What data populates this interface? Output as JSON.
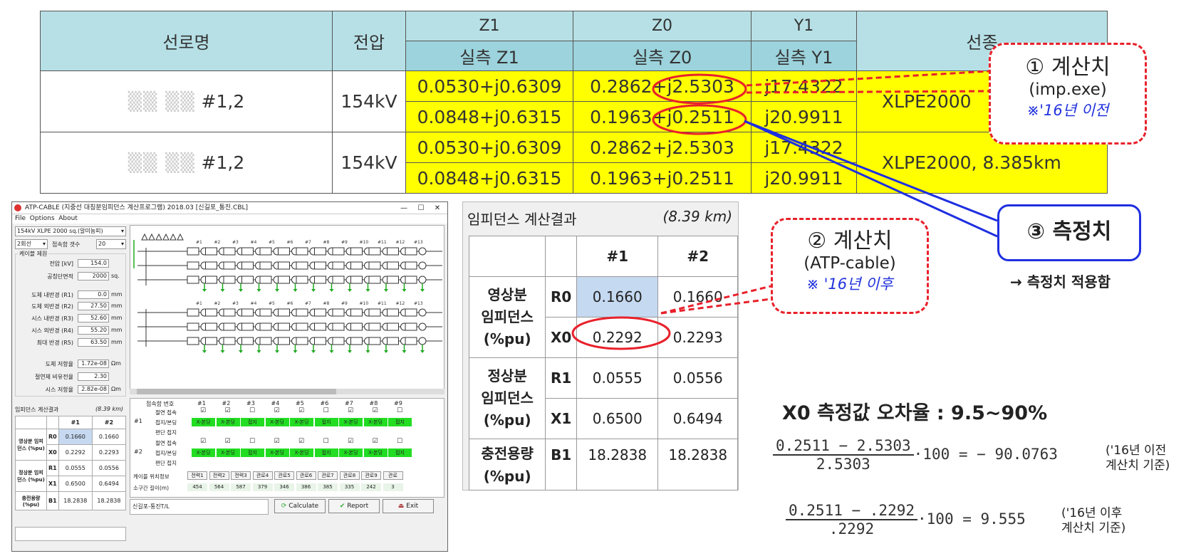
{
  "top_table": {
    "h_name": "선로명",
    "h_voltage": "전압",
    "h_z1": "Z1",
    "h_z0": "Z0",
    "h_y1": "Y1",
    "h_type": "선종",
    "h_meas_z1": "실측 Z1",
    "h_meas_z0": "실측 Z0",
    "h_meas_y1": "실측 Y1",
    "rows": [
      {
        "name": "#1,2",
        "voltage": "154kV",
        "z1_a": "0.0530+j0.6309",
        "z0_a": "0.2862+j2.5303",
        "y1_a": "j17.4322",
        "z1_b": "0.0848+j0.6315",
        "z0_b": "0.1963+j0.2511",
        "y1_b": "j20.9911",
        "type": "XLPE2000"
      },
      {
        "name": "#1,2",
        "voltage": "154kV",
        "z1_a": "0.0530+j0.6309",
        "z0_a": "0.2862+j2.5303",
        "y1_a": "j17.4322",
        "z1_b": "0.0848+j0.6315",
        "z0_b": "0.1963+j0.2511",
        "y1_b": "j20.9911",
        "type": "XLPE2000, 8.385km"
      }
    ]
  },
  "callouts": {
    "c1_title": "① 계산치",
    "c1_sub": "(imp.exe)",
    "c1_note": "※'16년 이전",
    "c2_title": "② 계산치",
    "c2_sub": "(ATP-cable)",
    "c2_note": "※ '16년 이후",
    "c3_title": "③ 측정치",
    "c3_arrow_note": "→ 측정치 적용함"
  },
  "atp": {
    "title": "ATP-CABLE (지중선 대칭분임피던스 계산프로그램) 2018.03 [신길포_통진.CBL]",
    "menu": [
      "File",
      "Options",
      "About"
    ],
    "cable_select": "154kV XLPE 2000 sq.(알미늄피)",
    "circuit_select": "2회선",
    "junction_label": "접속함 갯수",
    "junction_value": "20",
    "group_label": "케이블 제원",
    "params": [
      {
        "label": "전압 [kV]",
        "value": "154.0",
        "unit": ""
      },
      {
        "label": "공칭단면적",
        "value": "2000",
        "unit": "sq."
      },
      {
        "label": "도체 내반경 (R1)",
        "value": "0.0",
        "unit": "mm"
      },
      {
        "label": "도체 외반경 (R2)",
        "value": "27.50",
        "unit": "mm"
      },
      {
        "label": "시스 내반경 (R3)",
        "value": "52.60",
        "unit": "mm"
      },
      {
        "label": "시스 외반경 (R4)",
        "value": "55.20",
        "unit": "mm"
      },
      {
        "label": "최대 반경 (R5)",
        "value": "63.50",
        "unit": "mm"
      }
    ],
    "params2": [
      {
        "label": "도체 저항율",
        "value": "1.72e-08",
        "unit": "Ωm"
      },
      {
        "label": "절연체 비유전율",
        "value": "2.30",
        "unit": ""
      },
      {
        "label": "시스 저항율",
        "value": "2.82e-08",
        "unit": "Ωm"
      }
    ],
    "result_title": "임피던스 계산결과",
    "result_len": "(8.39 km)",
    "result": {
      "h1": "#1",
      "h2": "#2",
      "g1": "영상분 임피던스 (%pu)",
      "g2": "정상분 임피던스 (%pu)",
      "g3": "충전용량 (%pu)",
      "r0": [
        "R0",
        "0.1660",
        "0.1660"
      ],
      "x0": [
        "X0",
        "0.2292",
        "0.2293"
      ],
      "r1": [
        "R1",
        "0.0555",
        "0.0556"
      ],
      "x1": [
        "X1",
        "0.6500",
        "0.6494"
      ],
      "b1": [
        "B1",
        "18.2838",
        "18.2838"
      ]
    },
    "grid_header": [
      "접속함 번호",
      "#1",
      "#2",
      "#3",
      "#4",
      "#5",
      "#6",
      "#7",
      "#8",
      "#9"
    ],
    "grid_rows": [
      "절연 접속",
      "접지/본딩",
      "편단 접지",
      "절연 접속",
      "접지/본딩",
      "편단 접지"
    ],
    "grid_group": [
      "#1",
      "#2"
    ],
    "bond_cells": [
      "X-본딩",
      "X-본딩",
      "접지",
      "X-본딩",
      "X-본딩",
      "접지",
      "X-본딩",
      "X-본딩",
      "접지"
    ],
    "pos_label": "케이블 위치정보",
    "pos_values": [
      "전력1",
      "전력2",
      "전력3",
      "관로4",
      "관로5",
      "관로6",
      "관로7",
      "관로8",
      "관로9",
      "관로"
    ],
    "len_label": "소구간 길이(m)",
    "len_values": [
      "454",
      "564",
      "587",
      "379",
      "346",
      "386",
      "385",
      "335",
      "242",
      "3"
    ],
    "node_labels": [
      "#1",
      "#2",
      "#3",
      "#4",
      "#5",
      "#6",
      "#7",
      "#8",
      "#9",
      "#10",
      "#11",
      "#12",
      "#13"
    ],
    "status_text": "신길포-통진T/L",
    "btn_calc": "Calculate",
    "btn_report": "Report",
    "btn_exit": "Exit"
  },
  "imp_panel": {
    "title": "임피던스 계산결과",
    "length": "(8.39 km)",
    "h1": "#1",
    "h2": "#2",
    "g1a": "영상분",
    "g1b": "임피던스",
    "g1c": "(%pu)",
    "g2a": "정상분",
    "g2b": "임피던스",
    "g2c": "(%pu)",
    "g3a": "충전용량",
    "g3b": "(%pu)",
    "rows": [
      {
        "k": "R0",
        "a": "0.1660",
        "b": "0.1660"
      },
      {
        "k": "X0",
        "a": "0.2292",
        "b": "0.2293"
      },
      {
        "k": "R1",
        "a": "0.0555",
        "b": "0.0556"
      },
      {
        "k": "X1",
        "a": "0.6500",
        "b": "0.6494"
      },
      {
        "k": "B1",
        "a": "18.2838",
        "b": "18.2838"
      }
    ]
  },
  "error": {
    "title": "X0 측정값 오차율 : 9.5~90%",
    "f1_num": "0.2511 − 2.5303",
    "f1_den": "2.5303",
    "f1_rest": "·100 = − 90.0763",
    "f1_note1": "('16년 이전",
    "f1_note2": "계산치 기준)",
    "f2_num": "0.2511 − .2292",
    "f2_den": ".2292",
    "f2_rest": "·100 = 9.555",
    "f2_note1": "('16년 이후",
    "f2_note2": "계산치 기준)"
  }
}
